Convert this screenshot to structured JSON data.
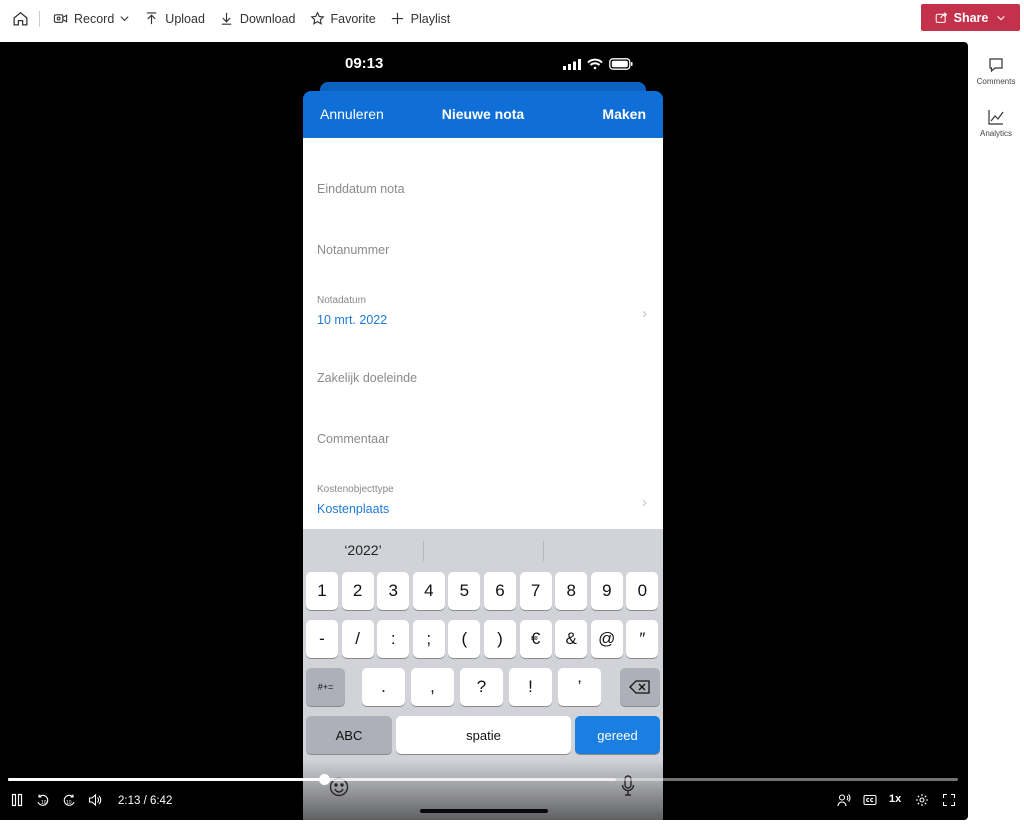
{
  "toolbar": {
    "home_icon": "home-icon",
    "record_label": "Record",
    "upload_label": "Upload",
    "download_label": "Download",
    "favorite_label": "Favorite",
    "playlist_label": "Playlist",
    "share_label": "Share"
  },
  "side_rail": {
    "comments_label": "Comments",
    "analytics_label": "Analytics"
  },
  "phone": {
    "status_time": "09:13",
    "nav": {
      "cancel": "Annuleren",
      "title": "Nieuwe nota",
      "create": "Maken"
    },
    "fields": {
      "end_date": "Einddatum nota",
      "note_number": "Notanummer",
      "note_date_label": "Notadatum",
      "note_date_value": "10 mrt. 2022",
      "business_purpose": "Zakelijk doeleinde",
      "comment": "Commentaar",
      "cost_object_label": "Kostenobjecttype",
      "cost_object_value": "Kostenplaats"
    },
    "keyboard": {
      "suggestion": "‘2022’",
      "row1": [
        "1",
        "2",
        "3",
        "4",
        "5",
        "6",
        "7",
        "8",
        "9",
        "0"
      ],
      "row2": [
        "-",
        "/",
        ":",
        ";",
        "(",
        ")",
        "€",
        "&",
        "@",
        "″"
      ],
      "row3": [
        ".",
        ",",
        "?",
        "!",
        "’"
      ],
      "symbols_key": "#+=",
      "abc_key": "ABC",
      "space_key": "spatie",
      "done_key": "gereed"
    }
  },
  "player": {
    "timecode": "2:13 / 6:42",
    "progress_fraction": 0.333,
    "buffered_fraction": 0.64,
    "speed": "1x",
    "accent": "#c4314b"
  }
}
